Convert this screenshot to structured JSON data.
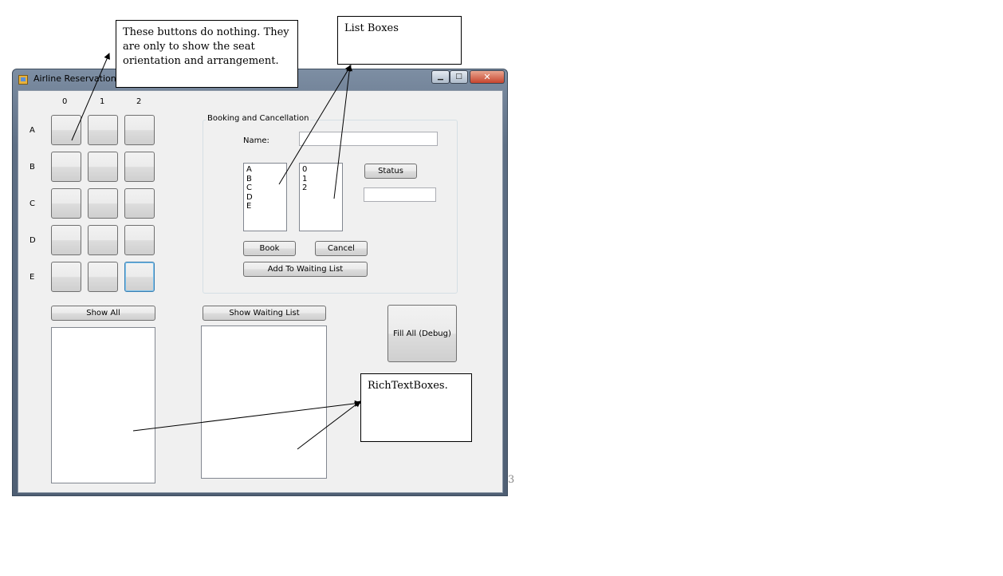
{
  "window": {
    "title": "Airline Reservation",
    "minimize_glyph": "▁",
    "maximize_glyph": "□",
    "close_glyph": "✕"
  },
  "seat_grid": {
    "columns": [
      "0",
      "1",
      "2"
    ],
    "rows": [
      "A",
      "B",
      "C",
      "D",
      "E"
    ]
  },
  "booking": {
    "group_title": "Booking and Cancellation",
    "name_label": "Name:",
    "name_value": "",
    "row_list": [
      "A",
      "B",
      "C",
      "D",
      "E"
    ],
    "col_list": [
      "0",
      "1",
      "2"
    ],
    "status_button": "Status",
    "status_value": "",
    "book_button": "Book",
    "cancel_button": "Cancel",
    "add_waiting_button": "Add To Waiting List"
  },
  "bottom": {
    "show_all_button": "Show All",
    "show_waiting_button": "Show Waiting List",
    "fill_all_button": "Fill All (Debug)"
  },
  "callouts": {
    "buttons_note": "These buttons do nothing. They are only to show the seat orientation and arrangement.",
    "list_boxes": "List Boxes",
    "rich_text_boxes": "RichTextBoxes."
  },
  "page_number": "3"
}
